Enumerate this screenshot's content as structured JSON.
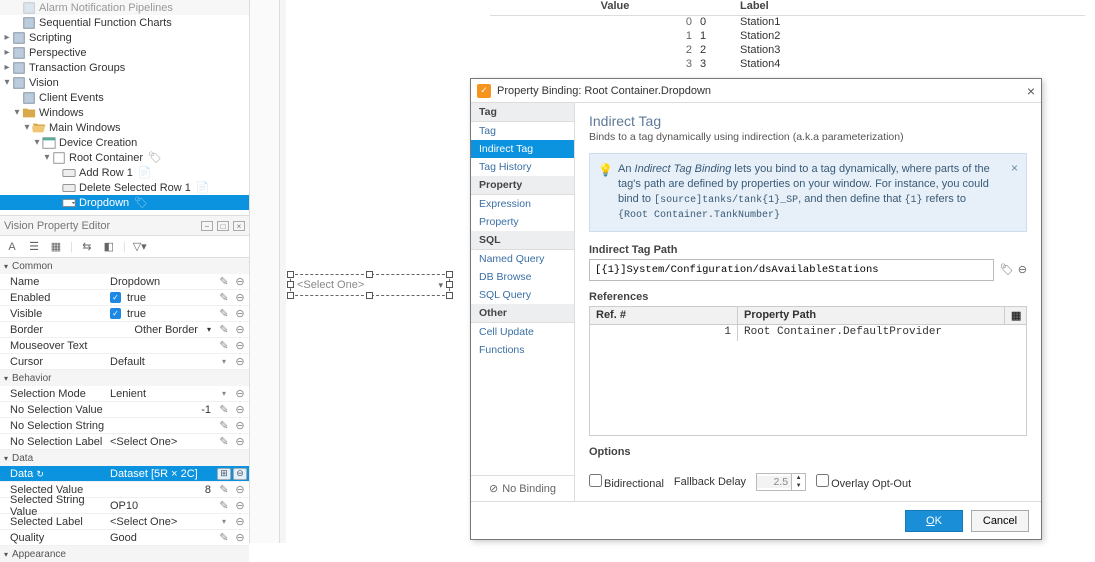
{
  "nav": {
    "items": [
      {
        "indent": 1,
        "tw": "",
        "icon": "pipeline",
        "label": "Alarm Notification Pipelines",
        "dim": true
      },
      {
        "indent": 1,
        "tw": "",
        "icon": "sfc",
        "label": "Sequential Function Charts"
      },
      {
        "indent": 0,
        "tw": "▸",
        "icon": "script",
        "label": "Scripting"
      },
      {
        "indent": 0,
        "tw": "▸",
        "icon": "perspective",
        "label": "Perspective"
      },
      {
        "indent": 0,
        "tw": "▸",
        "icon": "txn",
        "label": "Transaction Groups"
      },
      {
        "indent": 0,
        "tw": "▾",
        "icon": "vision",
        "label": "Vision"
      },
      {
        "indent": 1,
        "tw": "",
        "icon": "event",
        "label": "Client Events"
      },
      {
        "indent": 1,
        "tw": "▾",
        "icon": "folder",
        "label": "Windows"
      },
      {
        "indent": 2,
        "tw": "▾",
        "icon": "folder-open",
        "label": "Main Windows"
      },
      {
        "indent": 3,
        "tw": "▾",
        "icon": "window",
        "label": "Device Creation"
      },
      {
        "indent": 4,
        "tw": "▾",
        "icon": "container",
        "label": "Root Container",
        "trail": "tag"
      },
      {
        "indent": 5,
        "tw": "",
        "icon": "btn",
        "label": "Add Row 1",
        "trail": "script"
      },
      {
        "indent": 5,
        "tw": "",
        "icon": "btn",
        "label": "Delete Selected Row 1",
        "trail": "script"
      },
      {
        "indent": 5,
        "tw": "",
        "icon": "dropdown",
        "label": "Dropdown",
        "trail": "tag",
        "selected": true
      }
    ]
  },
  "prop_panel_title": "Vision Property Editor",
  "categories": {
    "common": "Common",
    "behavior": "Behavior",
    "data": "Data",
    "appearance": "Appearance"
  },
  "props": {
    "name_k": "Name",
    "name_v": "Dropdown",
    "enabled_k": "Enabled",
    "enabled_v": "true",
    "visible_k": "Visible",
    "visible_v": "true",
    "border_k": "Border",
    "border_v": "Other Border",
    "mot_k": "Mouseover Text",
    "mot_v": "",
    "cursor_k": "Cursor",
    "cursor_v": "Default",
    "selmode_k": "Selection Mode",
    "selmode_v": "Lenient",
    "nosv_k": "No Selection Value",
    "nosv_v": "-1",
    "noss_k": "No Selection String",
    "noss_v": "",
    "nosl_k": "No Selection Label",
    "nosl_v": "<Select One>",
    "data_k": "Data",
    "data_v": "Dataset [5R × 2C]",
    "selv_k": "Selected Value",
    "selv_v": "8",
    "selsv_k": "Selected String Value",
    "selsv_v": "OP10",
    "sell_k": "Selected Label",
    "sell_v": "<Select One>",
    "qual_k": "Quality",
    "qual_v": "Good"
  },
  "canvas": {
    "dd_placeholder": "<Select One>"
  },
  "chart_data": {
    "type": "table",
    "columns": [
      "Value",
      "Label"
    ],
    "rows": [
      {
        "idx": "0",
        "value": "0",
        "label": "Station1"
      },
      {
        "idx": "1",
        "value": "1",
        "label": "Station2"
      },
      {
        "idx": "2",
        "value": "2",
        "label": "Station3"
      },
      {
        "idx": "3",
        "value": "3",
        "label": "Station4"
      }
    ]
  },
  "dialog": {
    "title": "Property Binding: Root Container.Dropdown",
    "left": {
      "tag_cat": "Tag",
      "tag": "Tag",
      "indirect": "Indirect Tag",
      "hist": "Tag History",
      "prop_cat": "Property",
      "expr": "Expression",
      "prop": "Property",
      "sql_cat": "SQL",
      "nq": "Named Query",
      "dbb": "DB Browse",
      "sq": "SQL Query",
      "other_cat": "Other",
      "cu": "Cell Update",
      "fn": "Functions",
      "nobind": "No Binding"
    },
    "heading": "Indirect Tag",
    "sub": "Binds to a tag dynamically using indirection (a.k.a parameterization)",
    "info": {
      "l1a": "An ",
      "l1b": "Indirect Tag Binding",
      "l1c": " lets you bind to a tag dynamically, where parts of the tag's path are defined by properties on your window. For instance, you could bind to ",
      "code1": "[source]tanks/tank{1}_SP",
      "l2a": ", and then define that ",
      "code2": "{1}",
      "l2b": " refers to ",
      "code3": "{Root Container.TankNumber}"
    },
    "path_label": "Indirect Tag Path",
    "path_value": "[{1}]System/Configuration/dsAvailableStations",
    "ref_label": "References",
    "ref_h1": "Ref. #",
    "ref_h2": "Property Path",
    "ref_rows": [
      {
        "n": "1",
        "p": "Root Container.DefaultProvider"
      }
    ],
    "opts_label": "Options",
    "bidi": "Bidirectional",
    "fbd": "Fallback Delay",
    "fbd_v": "2.5",
    "ooo": "Overlay Opt-Out",
    "ok": "OK",
    "cancel": "Cancel"
  }
}
